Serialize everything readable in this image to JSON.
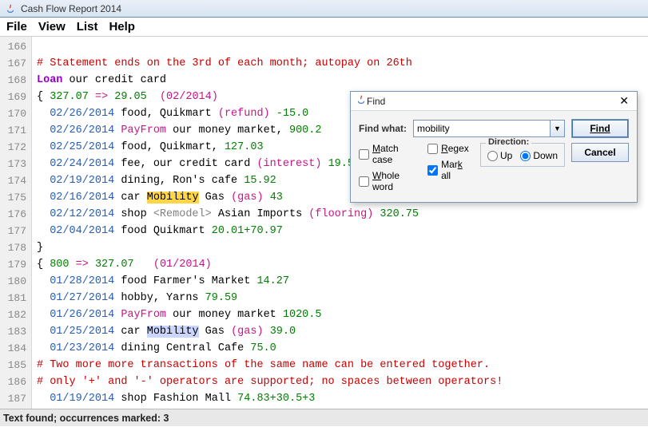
{
  "window": {
    "title": "Cash Flow Report 2014"
  },
  "menu": {
    "file": "File",
    "view": "View",
    "list": "List",
    "help": "Help"
  },
  "gutter_start": 166,
  "code_lines": [
    [
      [
        "plain",
        ""
      ]
    ],
    [
      [
        "comment",
        "# Statement ends on the 3rd of each month; autopay on 26th"
      ]
    ],
    [
      [
        "keyword",
        "Loan"
      ],
      [
        "plain",
        " our credit card"
      ]
    ],
    [
      [
        "plain",
        "{ "
      ],
      [
        "number",
        "327.07"
      ],
      [
        "plain",
        " "
      ],
      [
        "magenta",
        "=>"
      ],
      [
        "plain",
        " "
      ],
      [
        "number",
        "29.05"
      ],
      [
        "plain",
        "  "
      ],
      [
        "group",
        "(02/2014)"
      ]
    ],
    [
      [
        "plain",
        "  "
      ],
      [
        "date",
        "02/26/2014"
      ],
      [
        "plain",
        " food, Quikmart "
      ],
      [
        "paren",
        "(refund)"
      ],
      [
        "plain",
        " "
      ],
      [
        "number",
        "-15.0"
      ]
    ],
    [
      [
        "plain",
        "  "
      ],
      [
        "date",
        "02/26/2014"
      ],
      [
        "plain",
        " "
      ],
      [
        "magenta",
        "PayFrom"
      ],
      [
        "plain",
        " our money market, "
      ],
      [
        "number",
        "900.2"
      ]
    ],
    [
      [
        "plain",
        "  "
      ],
      [
        "date",
        "02/25/2014"
      ],
      [
        "plain",
        " food, Quikmart, "
      ],
      [
        "number",
        "127.03"
      ]
    ],
    [
      [
        "plain",
        "  "
      ],
      [
        "date",
        "02/24/2014"
      ],
      [
        "plain",
        " fee, our credit card "
      ],
      [
        "paren",
        "(interest)"
      ],
      [
        "plain",
        " "
      ],
      [
        "number",
        "19.5"
      ]
    ],
    [
      [
        "plain",
        "  "
      ],
      [
        "date",
        "02/19/2014"
      ],
      [
        "plain",
        " dining, Ron's cafe "
      ],
      [
        "number",
        "15.92"
      ]
    ],
    [
      [
        "plain",
        "  "
      ],
      [
        "date",
        "02/16/2014"
      ],
      [
        "plain",
        " car "
      ],
      [
        "match-cur",
        "Mobility"
      ],
      [
        "plain",
        " Gas "
      ],
      [
        "paren",
        "(gas)"
      ],
      [
        "plain",
        " "
      ],
      [
        "number",
        "43"
      ]
    ],
    [
      [
        "plain",
        "  "
      ],
      [
        "date",
        "02/12/2014"
      ],
      [
        "plain",
        " shop "
      ],
      [
        "tag",
        "<Remodel>"
      ],
      [
        "plain",
        " Asian Imports "
      ],
      [
        "paren",
        "(flooring)"
      ],
      [
        "plain",
        " "
      ],
      [
        "number",
        "320.75"
      ]
    ],
    [
      [
        "plain",
        "  "
      ],
      [
        "date",
        "02/04/2014"
      ],
      [
        "plain",
        " food Quikmart "
      ],
      [
        "number",
        "20.01+70.97"
      ]
    ],
    [
      [
        "plain",
        "}"
      ]
    ],
    [
      [
        "plain",
        "{ "
      ],
      [
        "number",
        "800"
      ],
      [
        "plain",
        " "
      ],
      [
        "magenta",
        "=>"
      ],
      [
        "plain",
        " "
      ],
      [
        "number",
        "327.07"
      ],
      [
        "plain",
        "   "
      ],
      [
        "group",
        "(01/2014)"
      ]
    ],
    [
      [
        "plain",
        "  "
      ],
      [
        "date",
        "01/28/2014"
      ],
      [
        "plain",
        " food Farmer's Market "
      ],
      [
        "number",
        "14.27"
      ]
    ],
    [
      [
        "plain",
        "  "
      ],
      [
        "date",
        "01/27/2014"
      ],
      [
        "plain",
        " hobby, Yarns "
      ],
      [
        "number",
        "79.59"
      ]
    ],
    [
      [
        "plain",
        "  "
      ],
      [
        "date",
        "01/26/2014"
      ],
      [
        "plain",
        " "
      ],
      [
        "magenta",
        "PayFrom"
      ],
      [
        "plain",
        " our money market "
      ],
      [
        "number",
        "1020.5"
      ]
    ],
    [
      [
        "plain",
        "  "
      ],
      [
        "date",
        "01/25/2014"
      ],
      [
        "plain",
        " car "
      ],
      [
        "match-other",
        "Mobility"
      ],
      [
        "plain",
        " Gas "
      ],
      [
        "paren",
        "(gas)"
      ],
      [
        "plain",
        " "
      ],
      [
        "number",
        "39.0"
      ]
    ],
    [
      [
        "plain",
        "  "
      ],
      [
        "date",
        "01/23/2014"
      ],
      [
        "plain",
        " dining Central Cafe "
      ],
      [
        "number",
        "75.0"
      ]
    ],
    [
      [
        "comment",
        "# Two more more transactions of the same name can be entered together."
      ]
    ],
    [
      [
        "comment",
        "# only '+' and '-' operators are supported; no spaces between operators!"
      ]
    ],
    [
      [
        "plain",
        "  "
      ],
      [
        "date",
        "01/19/2014"
      ],
      [
        "plain",
        " shop Fashion Mall "
      ],
      [
        "number",
        "74.83+30.5+3"
      ]
    ]
  ],
  "status": "Text found; occurrences marked: 3",
  "find": {
    "title": "Find",
    "label_find_what": "Find what:",
    "value": "mobility",
    "btn_find": "Find",
    "btn_cancel": "Cancel",
    "match_case": "Match case",
    "whole_word": "Whole word",
    "regex": "Regex",
    "mark_all": "Mark all",
    "mark_all_checked": true,
    "direction_legend": "Direction:",
    "up": "Up",
    "down": "Down",
    "direction_value": "down"
  }
}
